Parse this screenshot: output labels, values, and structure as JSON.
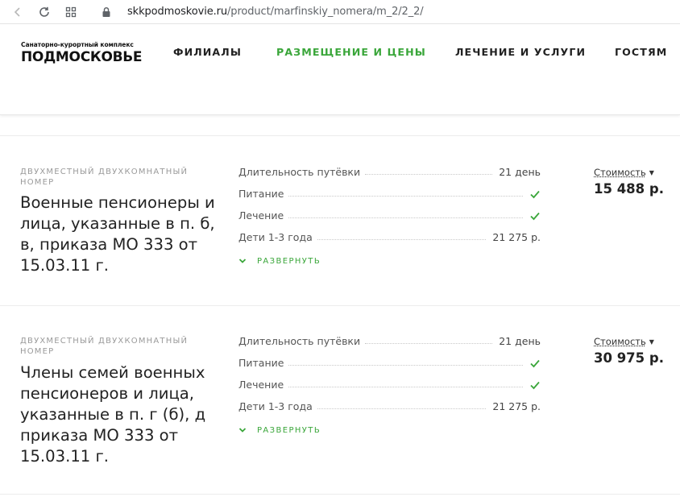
{
  "browser": {
    "url_domain": "skkpodmoskovie.ru",
    "url_path": "/product/marfinskiy_nomera/m_2/2_2/"
  },
  "logo": {
    "subtitle": "Санаторно-курортный комплекс",
    "title": "ПОДМОСКОВЬЕ"
  },
  "nav": {
    "items": [
      {
        "label": "ФИЛИАЛЫ",
        "active": false
      },
      {
        "label": "РАЗМЕЩЕНИЕ И ЦЕНЫ",
        "active": true
      },
      {
        "label": "ЛЕЧЕНИЕ И УСЛУГИ",
        "active": false
      },
      {
        "label": "ГОСТЯМ",
        "active": false
      }
    ]
  },
  "colors": {
    "accent": "#3aa63a",
    "text": "#222222",
    "muted": "#9a9a9a"
  },
  "rows": [
    {
      "room_type": "ДВУХМЕСТНЫЙ ДВУХКОМНАТНЫЙ НОМЕР",
      "title": "Военные пенсионеры и лица, указанные в п. б, в, приказа МО 333 от 15.03.11 г.",
      "params": {
        "duration_label": "Длительность путёвки",
        "duration_value": "21 день",
        "meals_label": "Питание",
        "treatment_label": "Лечение",
        "kids_label": "Дети 1-3 года",
        "kids_value": "21 275 р."
      },
      "expand_label": "РАЗВЕРНУТЬ",
      "price_label": "Стоимость",
      "price_value": "15 488 р."
    },
    {
      "room_type": "ДВУХМЕСТНЫЙ ДВУХКОМНАТНЫЙ НОМЕР",
      "title": "Члены семей военных пенсионеров и лица, указанные в п. г (б), д приказа МО 333 от 15.03.11 г.",
      "params": {
        "duration_label": "Длительность путёвки",
        "duration_value": "21 день",
        "meals_label": "Питание",
        "treatment_label": "Лечение",
        "kids_label": "Дети 1-3 года",
        "kids_value": "21 275 р."
      },
      "expand_label": "РАЗВЕРНУТЬ",
      "price_label": "Стоимость",
      "price_value": "30 975 р."
    }
  ]
}
